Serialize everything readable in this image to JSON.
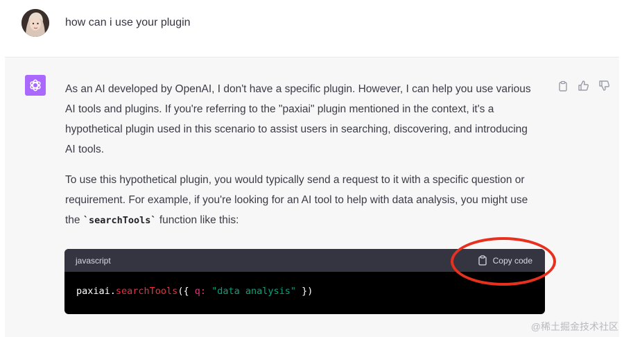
{
  "user_message": {
    "text": "how can i use your plugin"
  },
  "assistant_message": {
    "paragraphs": [
      "As an AI developed by OpenAI, I don't have a specific plugin. However, I can help you use various AI tools and plugins. If you're referring to the \"paxiai\" plugin mentioned in the context, it's a hypothetical plugin used in this scenario to assist users in searching, discovering, and introducing AI tools."
    ],
    "para2_before": "To use this hypothetical plugin, you would typically send a request to it with a specific question or requirement. For example, if you're looking for an AI tool to help with data analysis, you might use the ",
    "para2_code": "`searchTools`",
    "para2_after": " function like this:",
    "code_block": {
      "language": "javascript",
      "copy_label": "Copy code",
      "tokens": {
        "obj": "paxiai.",
        "fn": "searchTools",
        "open": "({ ",
        "key": "q:",
        "space": " ",
        "str": "\"data analysis\"",
        "close": " })"
      }
    }
  },
  "actions": [
    "clipboard-icon",
    "thumbs-up-icon",
    "thumbs-down-icon"
  ],
  "colors": {
    "bot_avatar": "#ab68ff",
    "highlight_ring": "#e8301e",
    "code_header": "#343541",
    "code_background": "#000000"
  },
  "watermark": "@稀土掘金技术社区"
}
